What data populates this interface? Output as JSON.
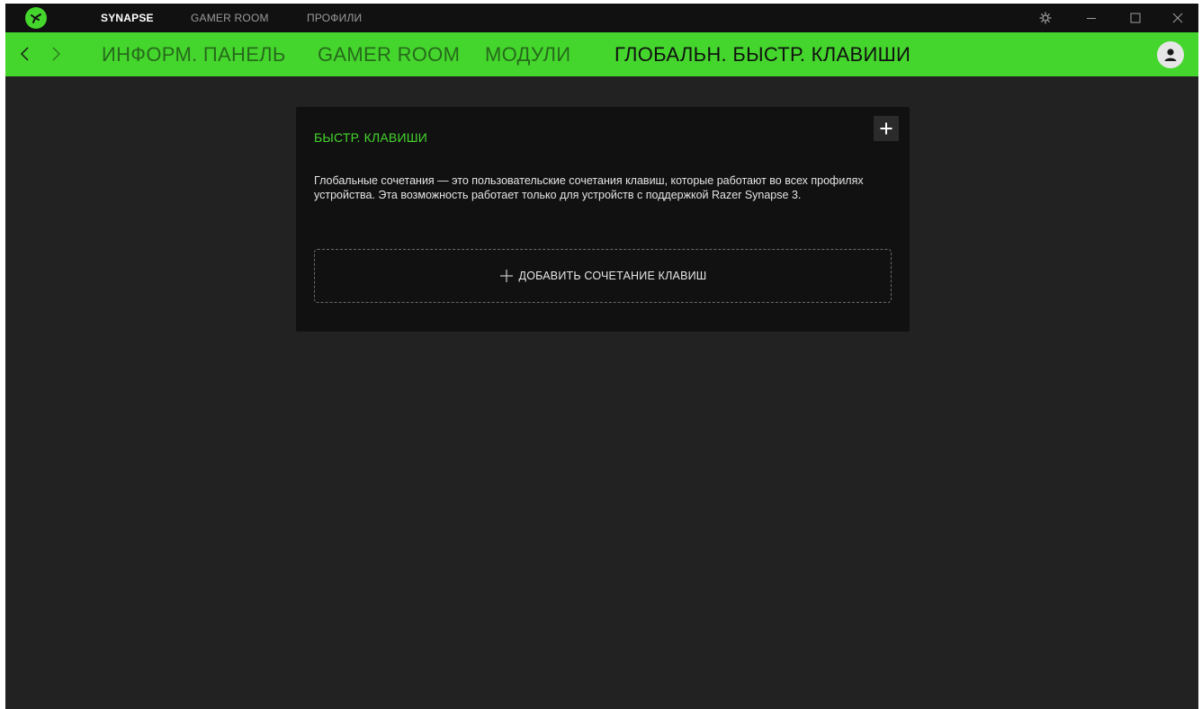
{
  "window": {
    "tabs": [
      {
        "label": "SYNAPSE",
        "active": true
      },
      {
        "label": "GAMER ROOM",
        "active": false
      },
      {
        "label": "ПРОФИЛИ",
        "active": false
      }
    ],
    "controls": [
      "settings-icon",
      "minimize-icon",
      "maximize-icon",
      "close-icon"
    ]
  },
  "subnav": {
    "tabs": [
      {
        "label": "ИНФОРМ. ПАНЕЛЬ",
        "active": false
      },
      {
        "label": "GAMER ROOM",
        "active": false
      },
      {
        "label": "МОДУЛИ",
        "active": false
      },
      {
        "label": "ГЛОБАЛЬН. БЫСТР. КЛАВИШИ",
        "active": true
      }
    ]
  },
  "card": {
    "title": "БЫСТР. КЛАВИШИ",
    "description": "Глобальные сочетания — это пользовательские сочетания клавиш, которые работают во всех профилях устройства. Эта возможность работает только для устройств с поддержкой Razer Synapse 3.",
    "add_label": "ДОБАВИТЬ СОЧЕТАНИЕ КЛАВИШ"
  },
  "colors": {
    "accent": "#44d62c",
    "titlebar": "#111111",
    "background": "#222222",
    "card": "#111111"
  }
}
